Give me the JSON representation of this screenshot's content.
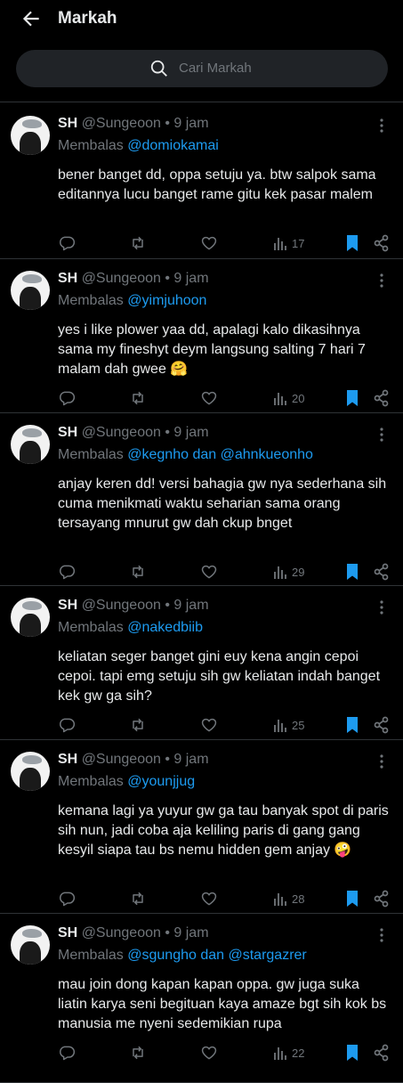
{
  "header": {
    "title": "Markah"
  },
  "search": {
    "placeholder": "Cari Markah"
  },
  "colors": {
    "accent": "#1d9bf0",
    "muted": "#71767b",
    "text": "#e7e9ea",
    "bg": "#000000"
  },
  "tweets": [
    {
      "name": "SH",
      "handle": "@Sungeoon",
      "dot": "•",
      "time": "9 jam",
      "reply_prefix": "Membalas",
      "reply_to": "@domiokamai",
      "body": "bener banget dd, oppa setuju ya. btw salpok sama editannya lucu banget rame gitu kek pasar malem",
      "views": "17"
    },
    {
      "name": "SH",
      "handle": "@Sungeoon",
      "dot": "•",
      "time": "9 jam",
      "reply_prefix": "Membalas",
      "reply_to": "@yimjuhoon",
      "body": "yes i like plower yaa dd, apalagi kalo dikasihnya sama my fineshyt deym langsung salting 7 hari 7 malam dah gwee 🤗",
      "views": "20"
    },
    {
      "name": "SH",
      "handle": "@Sungeoon",
      "dot": "•",
      "time": "9 jam",
      "reply_prefix": "Membalas",
      "reply_to": "@kegnho dan @ahnkueonho",
      "body": "anjay keren dd! versi bahagia gw nya sederhana sih cuma menikmati waktu seharian sama orang tersayang mnurut gw dah ckup bnget",
      "views": "29"
    },
    {
      "name": "SH",
      "handle": "@Sungeoon",
      "dot": "•",
      "time": "9 jam",
      "reply_prefix": "Membalas",
      "reply_to": "@nakedbiib",
      "body": "keliatan seger banget gini euy kena angin cepoi cepoi. tapi emg setuju sih gw keliatan indah banget kek gw ga sih?",
      "views": "25"
    },
    {
      "name": "SH",
      "handle": "@Sungeoon",
      "dot": "•",
      "time": "9 jam",
      "reply_prefix": "Membalas",
      "reply_to": "@younjjug",
      "body": "kemana lagi ya yuyur gw ga tau banyak spot di paris sih nun, jadi coba aja keliling paris di gang gang kesyil siapa tau bs nemu hidden gem anjay 🤪",
      "views": "28"
    },
    {
      "name": "SH",
      "handle": "@Sungeoon",
      "dot": "•",
      "time": "9 jam",
      "reply_prefix": "Membalas",
      "reply_to": "@sgungho dan @stargazrer",
      "body": "mau join dong kapan kapan oppa. gw juga suka liatin karya seni begituan kaya amaze bgt sih kok bs manusia me nyeni sedemikian rupa",
      "views": "22"
    }
  ]
}
